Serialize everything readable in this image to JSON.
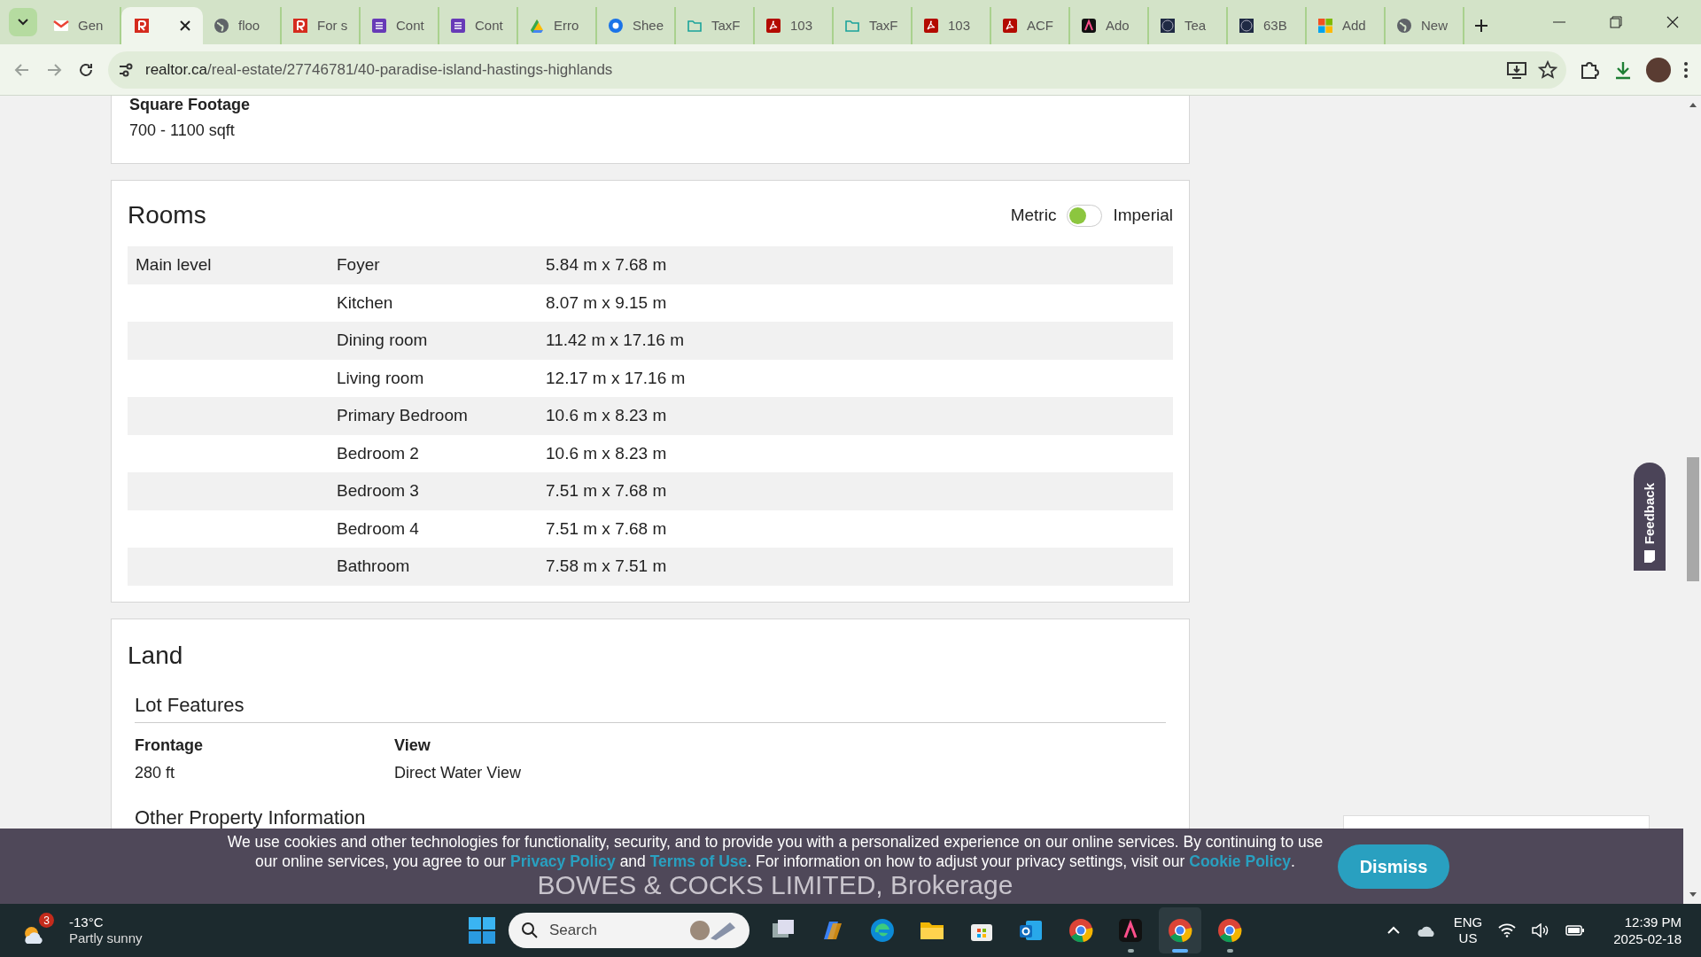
{
  "browser": {
    "tabs": [
      {
        "label": "Gen",
        "kind": "gmail",
        "selected": false
      },
      {
        "kind": "realtor",
        "selected": true
      },
      {
        "label": "floo",
        "kind": "globe",
        "selected": false
      },
      {
        "label": "For s",
        "kind": "realtor",
        "selected": false
      },
      {
        "label": "Cont",
        "kind": "forms",
        "selected": false
      },
      {
        "label": "Cont",
        "kind": "forms",
        "selected": false
      },
      {
        "label": "Erro",
        "kind": "drive",
        "selected": false
      },
      {
        "label": "Shee",
        "kind": "sheets",
        "selected": false
      },
      {
        "label": "TaxF",
        "kind": "folder",
        "selected": false
      },
      {
        "label": "103",
        "kind": "pdf",
        "selected": false
      },
      {
        "label": "TaxF",
        "kind": "folder",
        "selected": false
      },
      {
        "label": "103",
        "kind": "pdf",
        "selected": false
      },
      {
        "label": "ACF",
        "kind": "pdf",
        "selected": false
      },
      {
        "label": "Ado",
        "kind": "adobe",
        "selected": false
      },
      {
        "label": "Tea",
        "kind": "team",
        "selected": false
      },
      {
        "label": "63B",
        "kind": "team",
        "selected": false
      },
      {
        "label": "Add",
        "kind": "ms",
        "selected": false
      },
      {
        "label": "New",
        "kind": "globe",
        "selected": false
      }
    ],
    "url": "realtor.ca/real-estate/27746781/40-paradise-island-hastings-highlands"
  },
  "top_card": {
    "label": "Square Footage",
    "value": "700 - 1100 sqft"
  },
  "rooms": {
    "title": "Rooms",
    "toggle": {
      "left_label": "Metric",
      "right_label": "Imperial",
      "on": false
    },
    "rows": [
      {
        "level": "Main level",
        "room": "Foyer",
        "size": "5.84 m x 7.68 m"
      },
      {
        "room": "Kitchen",
        "size": "8.07 m x 9.15 m"
      },
      {
        "room": "Dining room",
        "size": "11.42 m x 17.16 m"
      },
      {
        "room": "Living room",
        "size": "12.17 m x 17.16 m"
      },
      {
        "room": "Primary Bedroom",
        "size": "10.6 m x 8.23 m"
      },
      {
        "room": "Bedroom 2",
        "size": "10.6 m x 8.23 m"
      },
      {
        "room": "Bedroom 3",
        "size": "7.51 m x 7.68 m"
      },
      {
        "room": "Bedroom 4",
        "size": "7.51 m x 7.68 m"
      },
      {
        "room": "Bathroom",
        "size": "7.58 m x 7.51 m"
      }
    ]
  },
  "land": {
    "title": "Land",
    "section": "Lot Features",
    "fields": [
      {
        "label": "Frontage",
        "value": "280 ft"
      },
      {
        "label": "View",
        "value": "Direct Water View"
      }
    ],
    "next_section": "Other Property Information"
  },
  "feedback": {
    "label": "Feedback"
  },
  "cookie_banner": {
    "text": "We use cookies and other technologies for functionality, security, and to provide you with a personalized experience on our online services. By continuing to use our online services, you agree to our ",
    "link1": "Privacy Policy",
    "and": " and ",
    "link2": "Terms of Use",
    "text2": ". For information on how to adjust your privacy settings, visit our ",
    "link3": "Cookie Policy",
    "end": ".",
    "button": "Dismiss"
  },
  "brokerage": "BOWES & COCKS LIMITED, Brokerage",
  "taskbar": {
    "weather": {
      "badge": "3",
      "temp": "-13°C",
      "desc": "Partly sunny"
    },
    "search_placeholder": "Search",
    "apps": [
      {
        "kind": "taskview",
        "running": false,
        "active": false
      },
      {
        "kind": "copilot",
        "running": false,
        "active": false
      },
      {
        "kind": "edge",
        "running": false,
        "active": false
      },
      {
        "kind": "explorer",
        "running": false,
        "active": false
      },
      {
        "kind": "store",
        "running": false,
        "active": false
      },
      {
        "kind": "outlook",
        "running": false,
        "active": false
      },
      {
        "kind": "chrome",
        "running": false,
        "active": false
      },
      {
        "kind": "adobe",
        "running": true,
        "active": false
      },
      {
        "kind": "chrome",
        "running": true,
        "active": true
      },
      {
        "kind": "chrome",
        "running": true,
        "active": false
      }
    ],
    "lang": "ENG",
    "region": "US",
    "time": "12:39 PM",
    "date": "2025-02-18"
  }
}
